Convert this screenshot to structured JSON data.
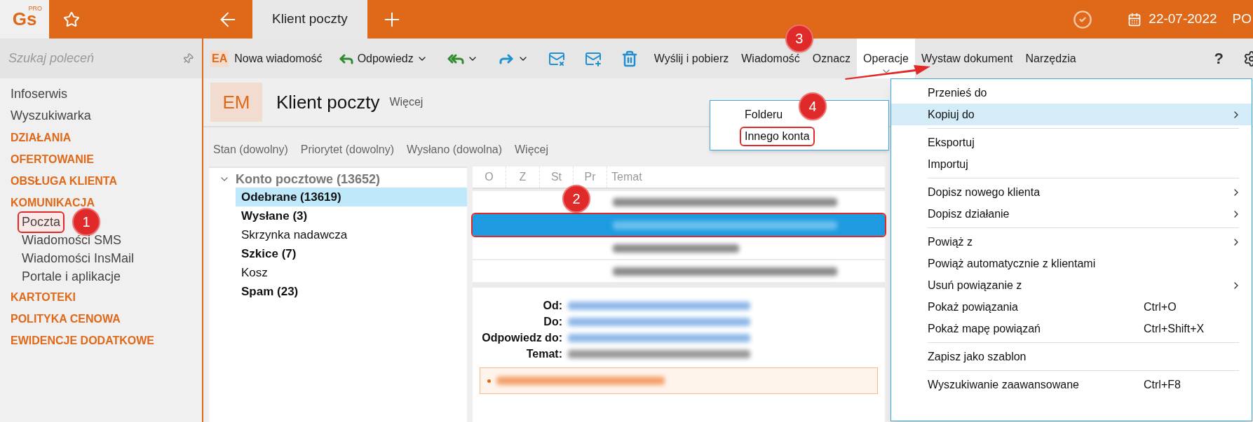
{
  "app": {
    "logo": "Gs",
    "logo_badge": "PRO"
  },
  "tabs": [
    {
      "label": "Klient poczty",
      "selected": true
    }
  ],
  "status": {
    "date": "22-07-2022",
    "user": "PO"
  },
  "search": {
    "placeholder": "Szukaj poleceń"
  },
  "sidebar": {
    "items": [
      {
        "label": "Infoserwis",
        "kind": "link"
      },
      {
        "label": "Wyszukiwarka",
        "kind": "link"
      },
      {
        "label": "DZIAŁANIA",
        "kind": "section"
      },
      {
        "label": "OFERTOWANIE",
        "kind": "section"
      },
      {
        "label": "OBSŁUGA KLIENTA",
        "kind": "section"
      },
      {
        "label": "KOMUNIKACJA",
        "kind": "section",
        "children": [
          {
            "label": "Poczta",
            "highlighted": true,
            "badge": "1"
          },
          {
            "label": "Wiadomości SMS",
            "highlighted": false
          },
          {
            "label": "Wiadomości InsMail",
            "highlighted": false
          },
          {
            "label": "Portale i aplikacje",
            "highlighted": false
          }
        ]
      },
      {
        "label": "KARTOTEKI",
        "kind": "section"
      },
      {
        "label": "POLITYKA CENOWA",
        "kind": "section"
      },
      {
        "label": "EWIDENCJE DODATKOWE",
        "kind": "section"
      }
    ]
  },
  "toolbar": {
    "items": [
      {
        "kind": "new",
        "badge": "EA",
        "label": "Nowa wiadomość"
      },
      {
        "kind": "reply",
        "label": "Odpowiedz",
        "dropdown": true
      },
      {
        "kind": "reply_all",
        "dropdown": true
      },
      {
        "kind": "forward",
        "dropdown": true
      },
      {
        "kind": "block"
      },
      {
        "kind": "receive"
      },
      {
        "kind": "delete"
      },
      {
        "kind": "text",
        "label": "Wyślij i pobierz",
        "selected": false
      },
      {
        "kind": "text",
        "label": "Wiadomość",
        "selected": false
      },
      {
        "kind": "text",
        "label": "Oznacz",
        "selected": false,
        "badge": "3"
      },
      {
        "kind": "text",
        "label": "Operacje",
        "selected": true
      },
      {
        "kind": "text",
        "label": "Wystaw dokument",
        "selected": false
      },
      {
        "kind": "text",
        "label": "Narzędzia",
        "selected": false
      }
    ],
    "help": "?"
  },
  "header": {
    "badge": "EM",
    "title": "Klient poczty",
    "more": "Więcej"
  },
  "filters": [
    "Stan (dowolny)",
    "Priorytet (dowolny)",
    "Wysłano (dowolna)",
    "Więcej"
  ],
  "folders": {
    "label": "Konto pocztowe (13652)",
    "expanded": true,
    "children": [
      {
        "label": "Odebrane (13619)",
        "bold": true,
        "selected": true
      },
      {
        "label": "Wysłane (3)",
        "bold": true,
        "selected": false
      },
      {
        "label": "Skrzynka nadawcza",
        "bold": false,
        "selected": false
      },
      {
        "label": "Szkice (7)",
        "bold": true,
        "selected": false
      },
      {
        "label": "Kosz",
        "bold": false,
        "selected": false
      },
      {
        "label": "Spam (23)",
        "bold": true,
        "selected": false
      }
    ]
  },
  "message_list": {
    "columns": [
      "O",
      "Z",
      "St",
      "Pr",
      "Temat"
    ],
    "badge": "2",
    "rows": [
      {
        "selected": false,
        "highlighted": false
      },
      {
        "selected": true,
        "highlighted": true
      },
      {
        "selected": false,
        "highlighted": false
      },
      {
        "selected": false,
        "highlighted": false
      }
    ]
  },
  "preview": {
    "fields": [
      "Od:",
      "Do:",
      "Odpowiedz do:",
      "Temat:"
    ]
  },
  "menu": {
    "items": [
      {
        "kind": "item",
        "label": "Przenieś do",
        "submenu": false,
        "selected": false
      },
      {
        "kind": "item",
        "label": "Kopiuj do",
        "submenu": true,
        "selected": true
      },
      {
        "kind": "separator"
      },
      {
        "kind": "item",
        "label": "Eksportuj",
        "submenu": false,
        "selected": false
      },
      {
        "kind": "item",
        "label": "Importuj",
        "submenu": false,
        "selected": false
      },
      {
        "kind": "separator"
      },
      {
        "kind": "item",
        "label": "Dopisz nowego klienta",
        "submenu": true,
        "selected": false
      },
      {
        "kind": "item",
        "label": "Dopisz działanie",
        "submenu": true,
        "selected": false
      },
      {
        "kind": "separator"
      },
      {
        "kind": "item",
        "label": "Powiąż z",
        "submenu": true,
        "selected": false
      },
      {
        "kind": "item",
        "label": "Powiąż automatycznie z klientami",
        "submenu": false,
        "selected": false
      },
      {
        "kind": "item",
        "label": "Usuń powiązanie z",
        "submenu": true,
        "selected": false
      },
      {
        "kind": "item",
        "label": "Pokaż powiązania",
        "shortcut": "Ctrl+O",
        "submenu": false,
        "selected": false
      },
      {
        "kind": "item",
        "label": "Pokaż mapę powiązań",
        "shortcut": "Ctrl+Shift+X",
        "submenu": false,
        "selected": false
      },
      {
        "kind": "separator"
      },
      {
        "kind": "item",
        "label": "Zapisz jako szablon",
        "submenu": false,
        "selected": false
      },
      {
        "kind": "separator"
      },
      {
        "kind": "item",
        "label": "Wyszukiwanie zaawansowane",
        "shortcut": "Ctrl+F8",
        "submenu": false,
        "selected": false
      }
    ]
  },
  "submenu": {
    "badge": "4",
    "items": [
      {
        "label": "Folderu",
        "highlighted": false
      },
      {
        "label": "Innego konta",
        "highlighted": true
      }
    ]
  }
}
